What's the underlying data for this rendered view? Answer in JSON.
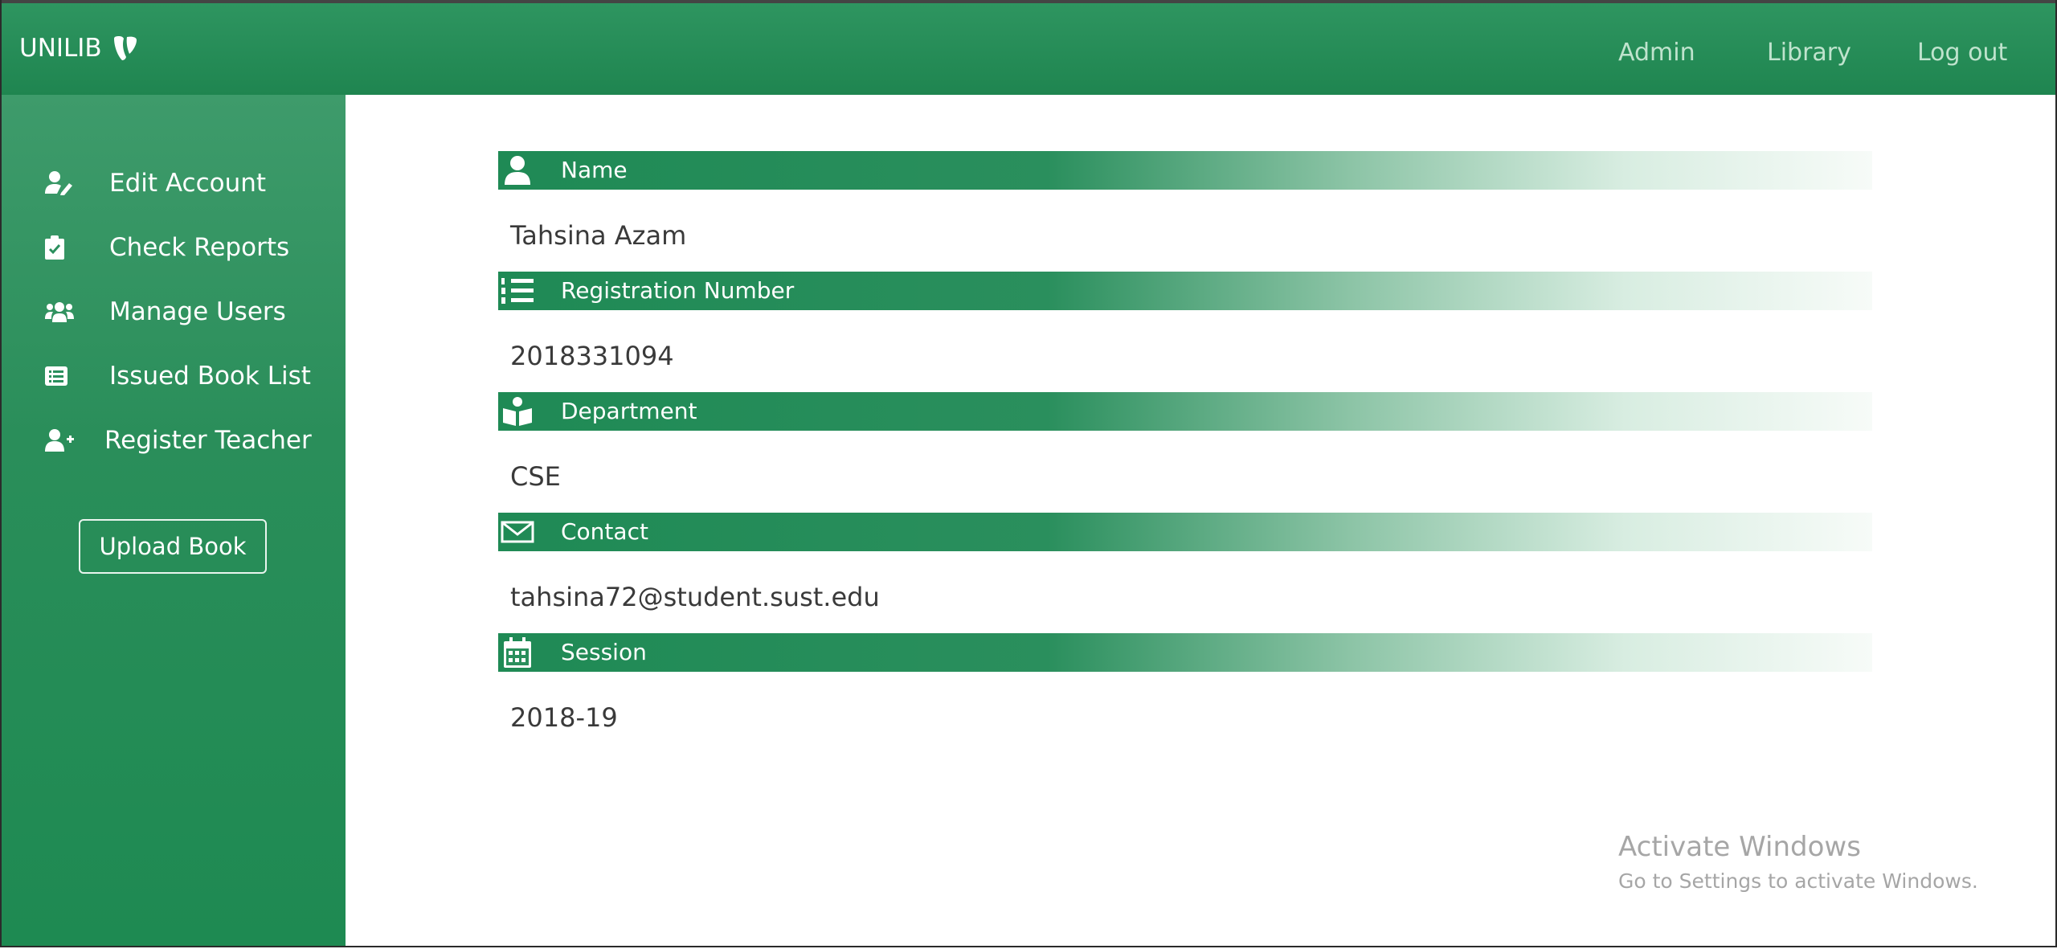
{
  "brand": {
    "name": "UNILIB",
    "logo_icon": "typo3-logo-icon"
  },
  "nav": {
    "links": [
      {
        "label": "Admin"
      },
      {
        "label": "Library"
      },
      {
        "label": "Log out"
      }
    ]
  },
  "sidebar": {
    "items": [
      {
        "label": "Edit Account",
        "icon": "user-edit-icon"
      },
      {
        "label": "Check Reports",
        "icon": "clipboard-check-icon"
      },
      {
        "label": "Manage Users",
        "icon": "users-icon"
      },
      {
        "label": "Issued Book List",
        "icon": "list-alt-icon"
      },
      {
        "label": "Register Teacher",
        "icon": "user-plus-icon"
      }
    ],
    "upload_label": "Upload Book"
  },
  "profile": {
    "fields": [
      {
        "label": "Name",
        "value": "Tahsina Azam",
        "icon": "user-icon"
      },
      {
        "label": "Registration Number",
        "value": "2018331094",
        "icon": "list-ol-icon"
      },
      {
        "label": "Department",
        "value": "CSE",
        "icon": "book-reader-icon"
      },
      {
        "label": "Contact",
        "value": "tahsina72@student.sust.edu",
        "icon": "envelope-icon"
      },
      {
        "label": "Session",
        "value": "2018-19",
        "icon": "calendar-icon"
      }
    ]
  },
  "watermark": {
    "title": "Activate Windows",
    "subtitle": "Go to Settings to activate Windows."
  },
  "colors": {
    "primary_green": "#1f8a55",
    "nav_link": "#bfe3cd",
    "text": "#3a3a3a"
  }
}
